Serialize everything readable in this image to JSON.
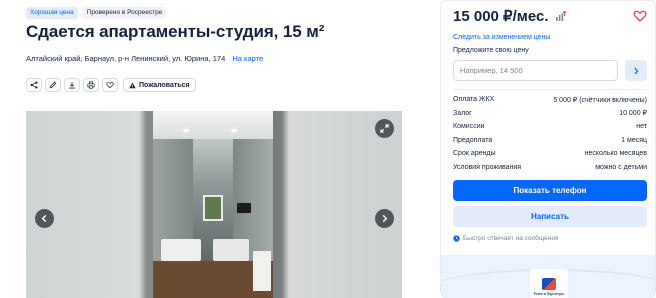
{
  "badges": {
    "good_price": "Хорошая цена",
    "verified": "Проверено в Росреестре"
  },
  "title": "Сдается апартаменты-студия, 15 м²",
  "address": {
    "text": "Алтайский край, Барнаул, р-н Ленинский, ул. Юрина, 174",
    "map_link": "На карте"
  },
  "toolbar": {
    "complain_label": "Пожаловаться"
  },
  "gallery": {
    "icons": [
      "expand-icon",
      "chevron-left-icon",
      "chevron-right-icon"
    ]
  },
  "card": {
    "price": "15 000 ₽/мес.",
    "follow_link": "Следить за изменением цены",
    "offer_label": "Предложите свою цену",
    "offer_placeholder": "Например, 14 500",
    "terms": [
      {
        "label": "Оплата ЖКХ",
        "value": "5 000 ₽ (счётчики включены)"
      },
      {
        "label": "Залог",
        "value": "10 000 ₽"
      },
      {
        "label": "Комиссии",
        "value": "нет"
      },
      {
        "label": "Предоплата",
        "value": "1 месяц"
      },
      {
        "label": "Срок аренды",
        "value": "несколько месяцев"
      },
      {
        "label": "Условия проживания",
        "value": "можно с детьми"
      }
    ],
    "phone_button": "Показать телефон",
    "write_button": "Написать",
    "reply_note": "Быстро отвечает на сообщения",
    "agency_name": "Ремв в Партнеры"
  },
  "colors": {
    "accent": "#0468ff",
    "accent_light": "#e4ecfb",
    "text": "#152242",
    "heart": "#e84260"
  }
}
